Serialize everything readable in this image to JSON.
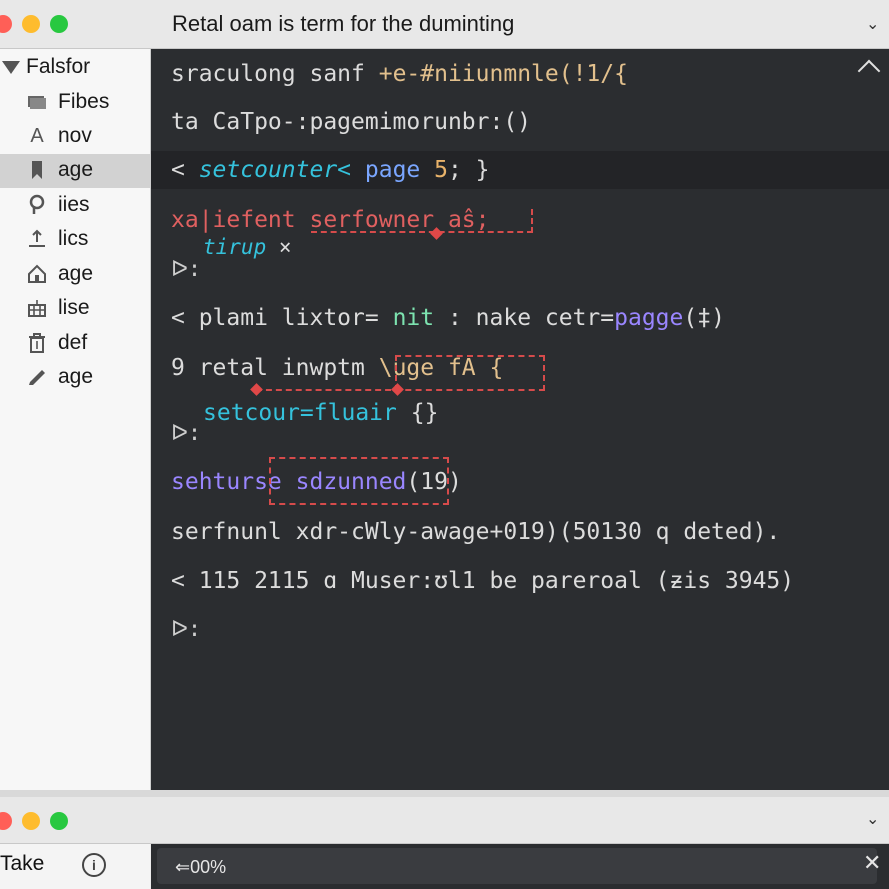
{
  "window": {
    "title": "Retal oam is term for the duminting",
    "controls": {
      "close_color": "#ff5f57",
      "minimize_color": "#febc2e",
      "zoom_color": "#28c840"
    }
  },
  "sidebar": {
    "header": "Falsfor",
    "items": [
      {
        "label": "Fibes",
        "icon": "folder-icon"
      },
      {
        "label": "nov",
        "icon": "font-icon"
      },
      {
        "label": "age",
        "icon": "bookmark-icon",
        "selected": true
      },
      {
        "label": "iies",
        "icon": "puzzle-icon"
      },
      {
        "label": "lics",
        "icon": "upload-icon"
      },
      {
        "label": "age",
        "icon": "home-icon"
      },
      {
        "label": "lise",
        "icon": "calendar-icon"
      },
      {
        "label": "def",
        "icon": "trash-icon"
      },
      {
        "label": "age",
        "icon": "pencil-icon"
      }
    ]
  },
  "editor": {
    "lines": [
      {
        "a": "sraculong sanf ",
        "b": "+e-#niiunmnle(!1/{"
      },
      {
        "a": "ta CaTpo-:pagemimorunbr:()"
      },
      {
        "a": "< ",
        "b": "setcounter<",
        "c": " page ",
        "d": "5",
        "e": "; }"
      },
      {
        "a": "xa|iefent serfowner aŝ;"
      },
      {
        "a": "tirup",
        "b": " ×"
      },
      {
        "a": "< plami lixtor= ",
        "b": "nit",
        "c": " : nake cetr=",
        "d": "pagge",
        "e": "(‡)"
      },
      {
        "a": "9 retal inwptm ",
        "b": "\\uge fA {"
      },
      {
        "a": "setcour=fluair",
        "b": " {}"
      },
      {
        "a": "sehturse ",
        "b": "sdzunned",
        "c": "(19)"
      },
      {
        "a": "serfnunl xdr-cWly-awage+019)(50130 q deted)."
      },
      {
        "a": "< 115 2115 ɑ Muser:ʊl1 be pareroal (ƶis 3945)"
      }
    ],
    "prompt": "ᐅ:"
  },
  "bottom": {
    "take_label": "Take",
    "info_icon": "i",
    "progress_text": "⇐00%",
    "progress_value": 0,
    "close_label": "✕",
    "collapse_label": "⌄"
  }
}
